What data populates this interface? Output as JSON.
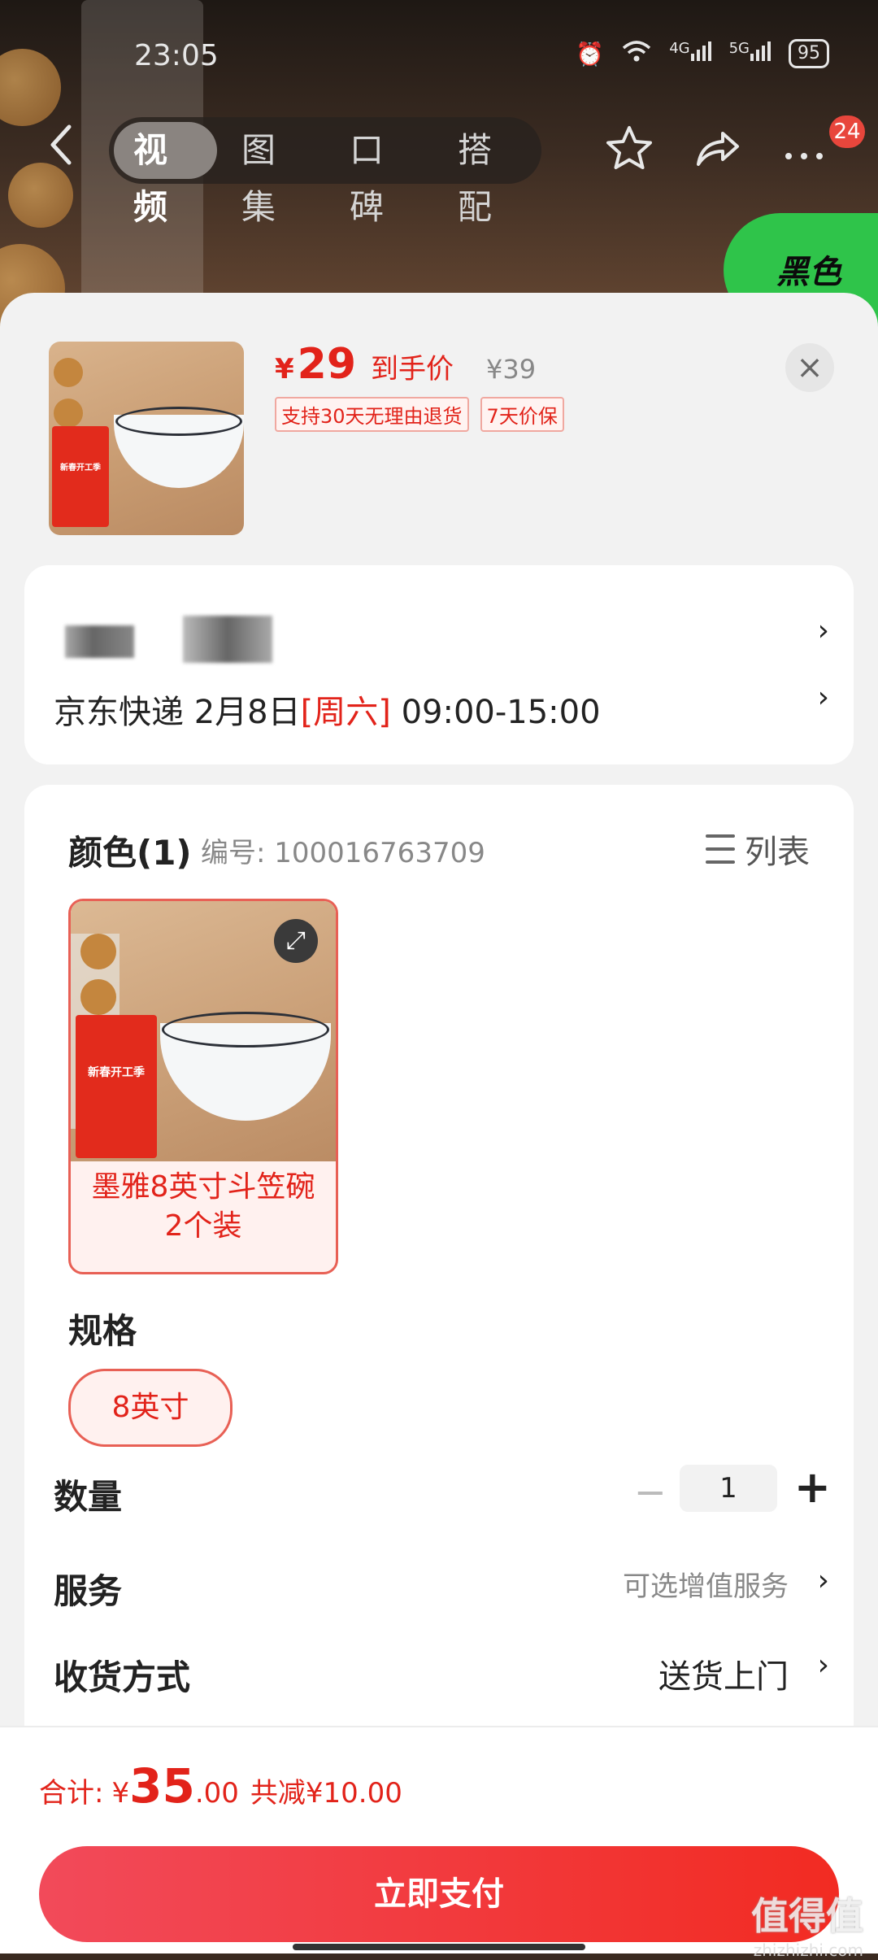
{
  "status_bar": {
    "time": "23:05",
    "network_4g": "4G",
    "network_5g": "5G",
    "battery": "95"
  },
  "top_nav": {
    "tabs": [
      {
        "label": "视频",
        "active": true
      },
      {
        "label": "图集"
      },
      {
        "label": "口碑"
      },
      {
        "label": "搭配"
      }
    ],
    "message_count": "24"
  },
  "background": {
    "badge_text": "黑色"
  },
  "product": {
    "price_currency": "¥",
    "price": "29",
    "price_tag": "到手价",
    "original_price": "¥39",
    "promos": [
      "支持30天无理由退货",
      "7天价保"
    ],
    "poster_title": "新春开工季"
  },
  "address": {
    "carrier": "京东快递",
    "date": "2月8日",
    "weekday": "[周六]",
    "time_window": "09:00-15:00"
  },
  "sku": {
    "color_header": "颜色(1)",
    "code_label": "编号: 100016763709",
    "list_label": "列表",
    "color_option": "墨雅8英寸斗笠碗2个装",
    "spec_header": "规格",
    "spec_option": "8英寸",
    "quantity_label": "数量",
    "quantity": "1",
    "minus_label": "−",
    "plus_label": "+",
    "service_label": "服务",
    "service_value": "可选增值服务",
    "shipping_label": "收货方式",
    "shipping_value": "送货上门"
  },
  "checkout": {
    "total_label": "合计:",
    "currency": "¥",
    "total_int": "35",
    "total_dec": ".00",
    "saved_label": "共减¥10.00",
    "pay_button": "立即支付"
  },
  "watermark": {
    "big": "值得值",
    "small": "zhizhizhi.com"
  },
  "colors": {
    "accent": "#e2231a",
    "pay_start": "#f24a5a",
    "pay_end": "#f22b22",
    "sheet_bg": "#f2f2f2"
  }
}
